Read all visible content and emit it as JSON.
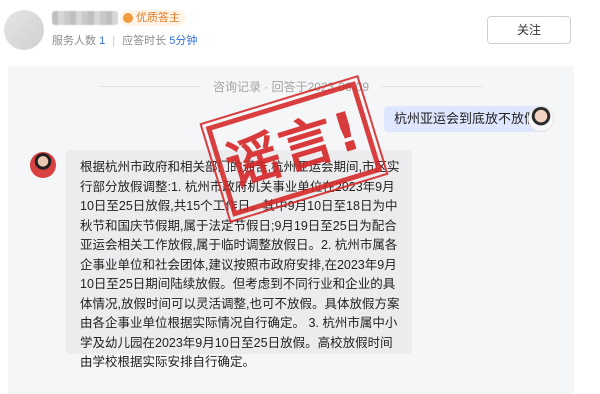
{
  "header": {
    "badge_label": "优质答主",
    "stats_service_label": "服务人数",
    "stats_service_value": "1",
    "stats_time_label": "应答时长",
    "stats_time_value": "5分钟",
    "follow_label": "关注"
  },
  "chat": {
    "record_label": "咨询记录 · 回答于2023-06-09",
    "question": "杭州亚运会到底放不放假",
    "answer": "根据杭州市政府和相关部门的通告,杭州亚运会期间,市区实行部分放假调整:1. 杭州市政府机关事业单位在2023年9月10日至25日放假,共15个工作日。其中9月10日至18日为中秋节和国庆节假期,属于法定节假日;9月19日至25日为配合亚运会相关工作放假,属于临时调整放假日。2. 杭州市属各企事业单位和社会团体,建议按照市政府安排,在2023年9月10日至25日期间陆续放假。但考虑到不同行业和企业的具体情况,放假时间可以灵活调整,也可不放假。具体放假方案由各企事业单位根据实际情况自行确定。 3. 杭州市属中小学及幼儿园在2023年9月10日至25日放假。高校放假时间由学校根据实际安排自行确定。"
  },
  "stamp": {
    "text": "谣言!",
    "color": "#d62626"
  },
  "colors": {
    "badge": "#e07a24",
    "stat_number": "#2d6ddb",
    "question_bubble": "#dfe6ff"
  }
}
